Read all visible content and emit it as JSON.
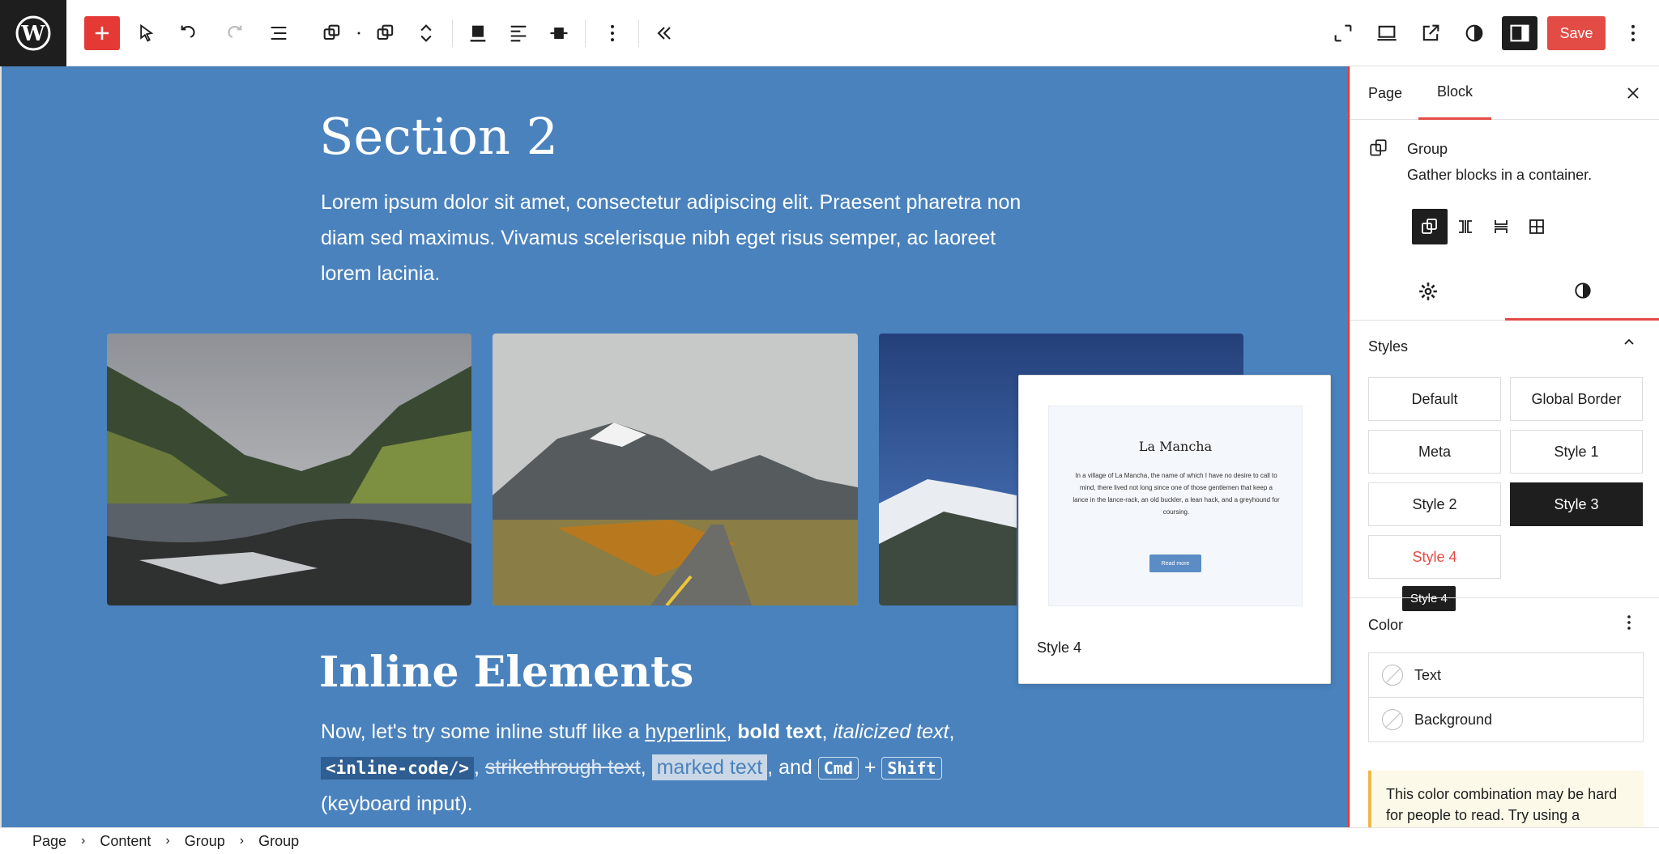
{
  "toolbar": {
    "save_label": "Save"
  },
  "canvas": {
    "section_title": "Section 2",
    "section_body": "Lorem ipsum dolor sit amet, consectetur adipiscing elit. Praesent pharetra non diam sed maximus. Vivamus scelerisque nibh eget risus semper, ac laoreet lorem lacinia.",
    "inline_title": "Inline Elements",
    "inline": {
      "lead": "Now, let's try some inline stuff like a ",
      "link": "hyperlink",
      "sep1": ", ",
      "bold": "bold text",
      "sep2": ", ",
      "italic": "italicized text",
      "sep3": ",",
      "code": "<inline-code/>",
      "sep4": ", ",
      "strike": "strikethrough text",
      "sep5": ", ",
      "mark": "marked text",
      "sep6": ", and ",
      "kbd1": "Cmd",
      "plus": " + ",
      "kbd2": "Shift",
      "tail": "(keyboard input)."
    }
  },
  "preview": {
    "card_title": "La Mancha",
    "card_text": "In a village of La Mancha, the name of which I have no desire to call to mind, there lived not long since one of those gentlemen that keep a lance in the lance-rack, an old buckler, a lean hack, and a greyhound for coursing.",
    "card_button": "Read more",
    "label": "Style 4"
  },
  "sidebar": {
    "tabs": [
      "Page",
      "Block"
    ],
    "block_name": "Group",
    "block_desc": "Gather blocks in a container.",
    "styles_heading": "Styles",
    "styles": [
      "Default",
      "Global Border",
      "Meta",
      "Style 1",
      "Style 2",
      "Style 3",
      "Style 4"
    ],
    "active_style": "Style 3",
    "tooltip": "Style 4",
    "color_heading": "Color",
    "color_items": [
      "Text",
      "Background"
    ],
    "warning": "This color combination may be hard for people to read. Try using a"
  },
  "breadcrumb": [
    "Page",
    "Content",
    "Group",
    "Group"
  ],
  "colors": {
    "accent": "#e34b45",
    "canvas_bg": "#4a82bd",
    "dark": "#1e1e1e"
  }
}
